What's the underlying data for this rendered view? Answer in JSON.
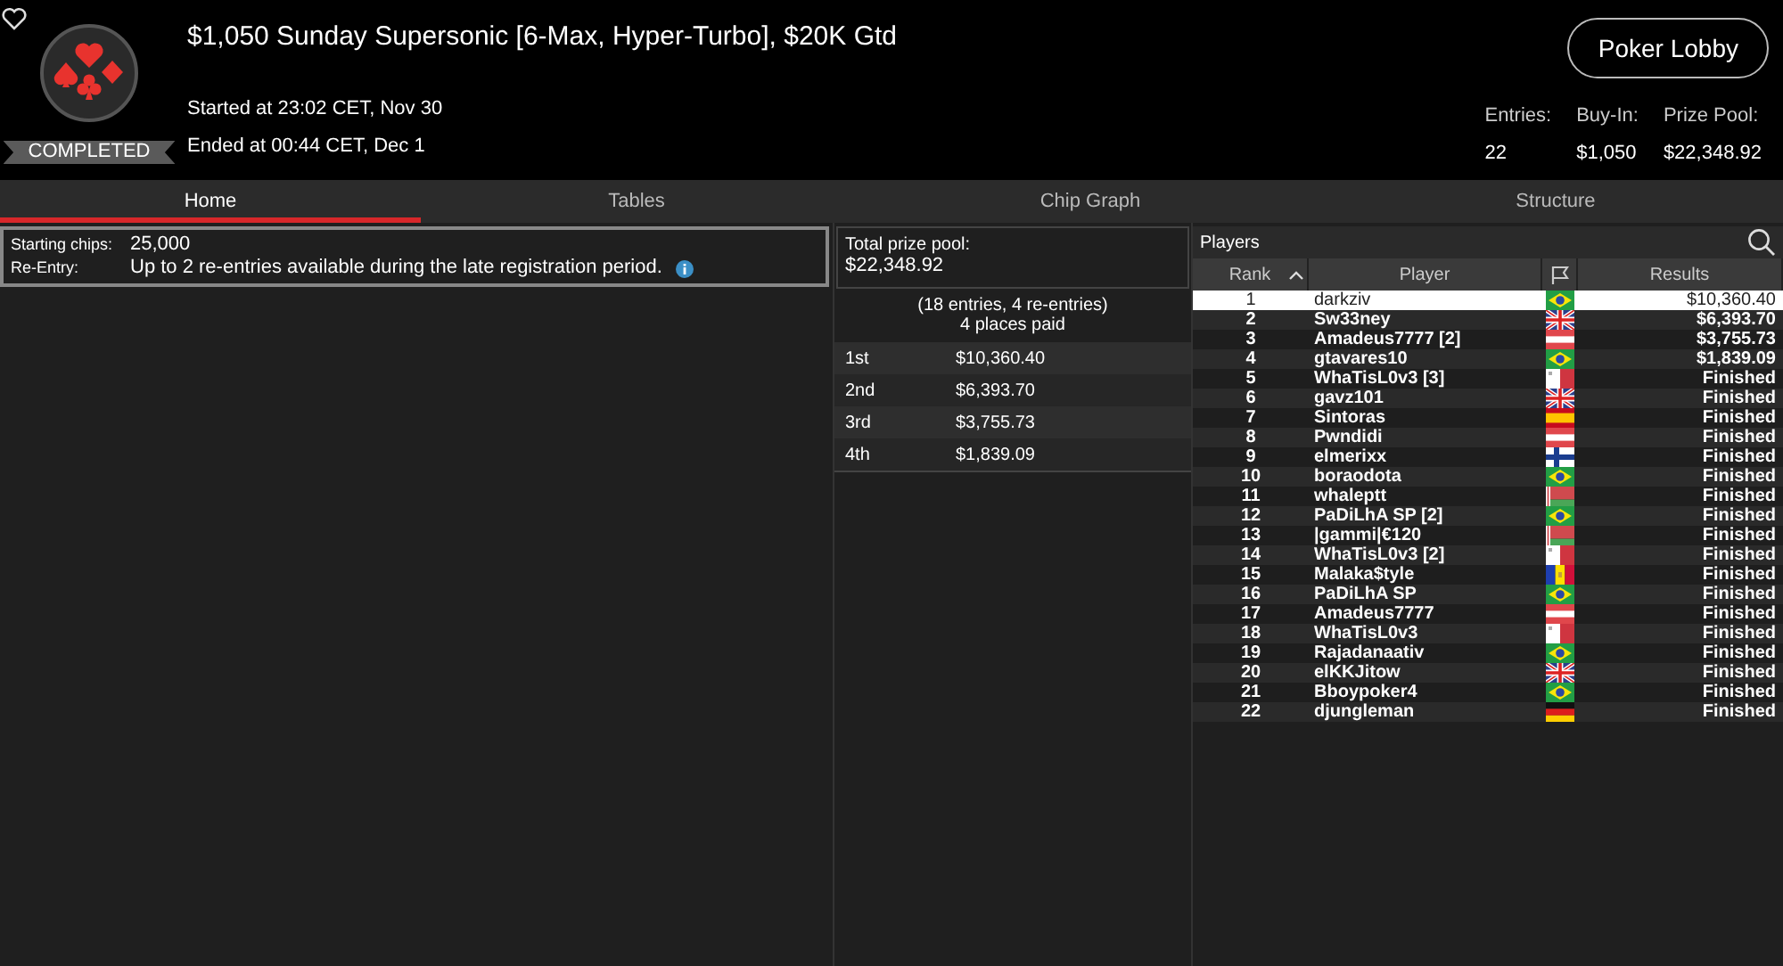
{
  "header": {
    "title": "$1,050 Sunday Supersonic [6-Max, Hyper-Turbo], $20K Gtd",
    "started": "Started at 23:02 CET, Nov 30",
    "ended": "Ended at 00:44 CET, Dec 1",
    "status": "COMPLETED",
    "lobby_button": "Poker Lobby",
    "stats": [
      {
        "label": "Entries:",
        "value": "22"
      },
      {
        "label": "Buy-In:",
        "value": "$1,050"
      },
      {
        "label": "Prize Pool:",
        "value": "$22,348.92"
      }
    ]
  },
  "tabs": [
    {
      "label": "Home",
      "selected": true
    },
    {
      "label": "Tables",
      "selected": false
    },
    {
      "label": "Chip Graph",
      "selected": false
    },
    {
      "label": "Structure",
      "selected": false
    }
  ],
  "info": [
    {
      "label": "Starting chips:",
      "value": "25,000",
      "info_icon": false
    },
    {
      "label": "Re-Entry:",
      "value": "Up to 2 re-entries available during the late registration period.",
      "info_icon": true
    }
  ],
  "prize": {
    "label": "Total prize pool:",
    "amount": "$22,348.92",
    "entries": "(18 entries, 4 re-entries)",
    "places": "4 places paid",
    "payouts": [
      {
        "place": "1st",
        "amount": "$10,360.40"
      },
      {
        "place": "2nd",
        "amount": "$6,393.70"
      },
      {
        "place": "3rd",
        "amount": "$3,755.73"
      },
      {
        "place": "4th",
        "amount": "$1,839.09"
      }
    ]
  },
  "players": {
    "title": "Players",
    "columns": [
      {
        "kind": "text",
        "label": "Rank",
        "sorted": true
      },
      {
        "kind": "text",
        "label": "Player",
        "sorted": false
      },
      {
        "kind": "flag"
      },
      {
        "kind": "text",
        "label": "Results",
        "sorted": false
      }
    ],
    "rows": [
      {
        "rank": "1",
        "player": "darkziv",
        "kind": "br",
        "result": "$10,360.40",
        "selected": true
      },
      {
        "rank": "2",
        "player": "Sw33ney",
        "kind": "gb",
        "result": "$6,393.70",
        "selected": false
      },
      {
        "rank": "3",
        "player": "Amadeus7777 [2]",
        "kind": "at",
        "result": "$3,755.73",
        "selected": false
      },
      {
        "rank": "4",
        "player": "gtavares10",
        "kind": "br",
        "result": "$1,839.09",
        "selected": false
      },
      {
        "rank": "5",
        "player": "WhaTisL0v3 [3]",
        "kind": "mt",
        "result": "Finished",
        "selected": false
      },
      {
        "rank": "6",
        "player": "gavz101",
        "kind": "gb",
        "result": "Finished",
        "selected": false
      },
      {
        "rank": "7",
        "player": "Sintoras",
        "kind": "es",
        "result": "Finished",
        "selected": false
      },
      {
        "rank": "8",
        "player": "Pwndidi",
        "kind": "at",
        "result": "Finished",
        "selected": false
      },
      {
        "rank": "9",
        "player": "elmerixx",
        "kind": "fi",
        "result": "Finished",
        "selected": false
      },
      {
        "rank": "10",
        "player": "boraodota",
        "kind": "br",
        "result": "Finished",
        "selected": false
      },
      {
        "rank": "11",
        "player": "whaleptt",
        "kind": "by",
        "result": "Finished",
        "selected": false
      },
      {
        "rank": "12",
        "player": "PaDiLhA SP [2]",
        "kind": "br",
        "result": "Finished",
        "selected": false
      },
      {
        "rank": "13",
        "player": "|gammi|€120",
        "kind": "by",
        "result": "Finished",
        "selected": false
      },
      {
        "rank": "14",
        "player": "WhaTisL0v3 [2]",
        "kind": "mt",
        "result": "Finished",
        "selected": false
      },
      {
        "rank": "15",
        "player": "Malaka$tyle",
        "kind": "ad",
        "result": "Finished",
        "selected": false
      },
      {
        "rank": "16",
        "player": "PaDiLhA SP",
        "kind": "br",
        "result": "Finished",
        "selected": false
      },
      {
        "rank": "17",
        "player": "Amadeus7777",
        "kind": "at",
        "result": "Finished",
        "selected": false
      },
      {
        "rank": "18",
        "player": "WhaTisL0v3",
        "kind": "mt",
        "result": "Finished",
        "selected": false
      },
      {
        "rank": "19",
        "player": "Rajadanaativ",
        "kind": "br",
        "result": "Finished",
        "selected": false
      },
      {
        "rank": "20",
        "player": "elKKJitow",
        "kind": "gb",
        "result": "Finished",
        "selected": false
      },
      {
        "rank": "21",
        "player": "Bboypoker4",
        "kind": "br",
        "result": "Finished",
        "selected": false
      },
      {
        "rank": "22",
        "player": "djungleman",
        "kind": "de",
        "result": "Finished",
        "selected": false
      }
    ]
  }
}
